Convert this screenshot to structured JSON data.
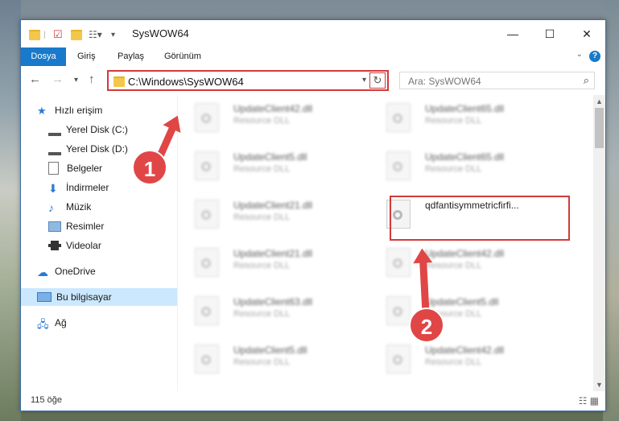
{
  "window": {
    "title": "SysWOW64"
  },
  "ribbon": {
    "tabs": [
      "Dosya",
      "Giriş",
      "Paylaş",
      "Görünüm"
    ],
    "help": "?"
  },
  "address": {
    "path": "C:\\Windows\\SysWOW64"
  },
  "search": {
    "placeholder": "Ara: SysWOW64"
  },
  "sidebar": {
    "items": [
      {
        "label": "Hızlı erişim",
        "icon": "star-icon"
      },
      {
        "label": "Yerel Disk (C:)",
        "icon": "drive-icon"
      },
      {
        "label": "Yerel Disk (D:)",
        "icon": "drive-icon"
      },
      {
        "label": "Belgeler",
        "icon": "document-icon"
      },
      {
        "label": "İndirmeler",
        "icon": "download-icon"
      },
      {
        "label": "Müzik",
        "icon": "music-icon"
      },
      {
        "label": "Resimler",
        "icon": "picture-icon"
      },
      {
        "label": "Videolar",
        "icon": "video-icon"
      },
      {
        "label": "OneDrive",
        "icon": "cloud-icon"
      },
      {
        "label": "Bu bilgisayar",
        "icon": "computer-icon"
      },
      {
        "label": "Ağ",
        "icon": "network-icon"
      }
    ]
  },
  "files": {
    "left": [
      {
        "name": "UpdateClient42.dll",
        "desc": "Resource DLL"
      },
      {
        "name": "UpdateClient5.dll",
        "desc": "Resource DLL"
      },
      {
        "name": "UpdateClient21.dll",
        "desc": "Resource DLL"
      },
      {
        "name": "UpdateClient21.dll",
        "desc": "Resource DLL"
      },
      {
        "name": "UpdateClient63.dll",
        "desc": "Resource DLL"
      },
      {
        "name": "UpdateClient5.dll",
        "desc": "Resource DLL"
      }
    ],
    "right": [
      {
        "name": "UpdateClient65.dll",
        "desc": "Resource DLL"
      },
      {
        "name": "UpdateClient65.dll",
        "desc": "Resource DLL"
      },
      {
        "name": "qdfantisymmetricfirfi...",
        "desc": ""
      },
      {
        "name": "UpdateClient42.dll",
        "desc": "Resource DLL"
      },
      {
        "name": "UpdateClient5.dll",
        "desc": "Resource DLL"
      },
      {
        "name": "UpdateClient42.dll",
        "desc": "Resource DLL"
      }
    ]
  },
  "status": {
    "count": "115 öğe"
  },
  "annotations": {
    "badge1": "1",
    "badge2": "2",
    "color": "#e04646"
  }
}
